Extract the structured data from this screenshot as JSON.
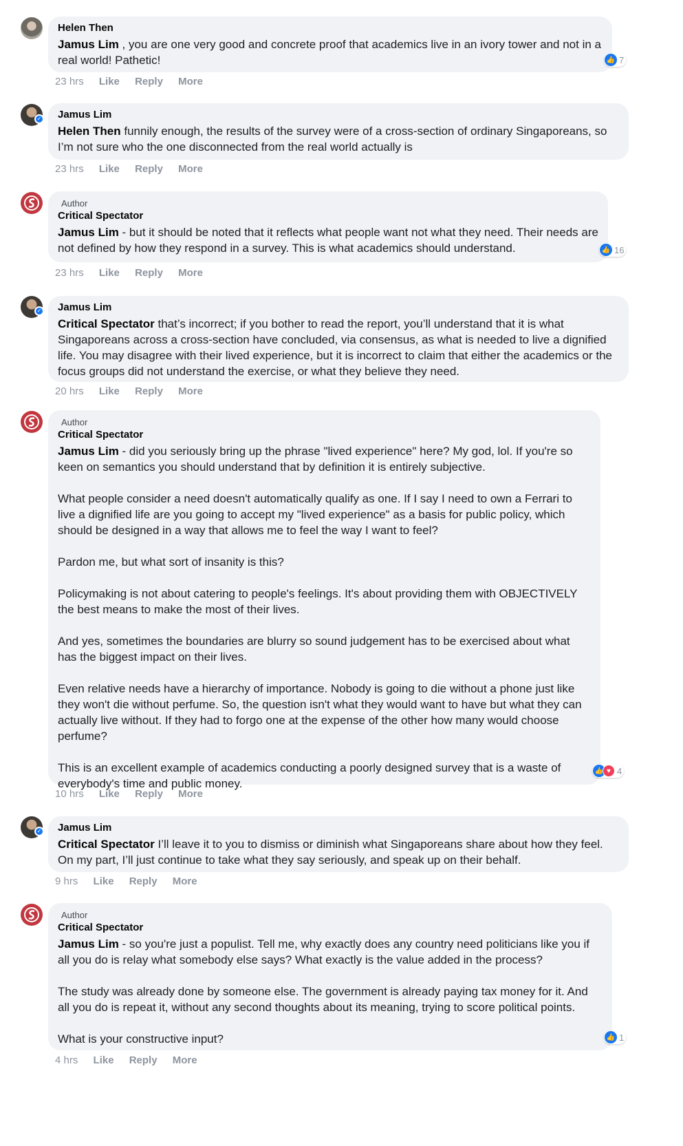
{
  "comments": [
    {
      "name": "Helen Then",
      "mention": "Jamus Lim",
      "paragraphs": [
        " , you are one very good and concrete proof that academics live in an ivory tower and not in a real world! Pathetic!"
      ],
      "time": "23 hrs",
      "reactions": "7"
    },
    {
      "name": "Jamus Lim",
      "mention": "Helen Then",
      "paragraphs": [
        " funnily enough, the results of the survey were of a cross-section of ordinary Singaporeans, so I’m not sure who the one disconnected from the real world actually is"
      ],
      "time": "23 hrs"
    },
    {
      "author_tag": "Author",
      "name": "Critical Spectator",
      "mention": "Jamus Lim",
      "paragraphs": [
        " - but it should be noted that it reflects what people want not what they need. Their needs are not defined by how they respond in a survey. This is what academics should understand."
      ],
      "time": "23 hrs",
      "reactions": "16"
    },
    {
      "name": "Jamus Lim",
      "mention": "Critical Spectator",
      "paragraphs": [
        " that’s incorrect; if you bother to read the report, you’ll understand that it is what Singaporeans across a cross-section have concluded, via consensus, as what is needed to live a dignified life. You may disagree with their lived experience, but it is incorrect to claim that either the academics or the focus groups did not understand the exercise, or what they believe they need."
      ],
      "time": "20 hrs"
    },
    {
      "author_tag": "Author",
      "name": "Critical Spectator",
      "mention": "Jamus Lim",
      "paragraphs": [
        " - did you seriously bring up the phrase \"lived experience\" here? My god, lol. If you're so keen on semantics you should understand that by definition it is entirely subjective.",
        "What people consider a need doesn't automatically qualify as one. If I say I need to own a Ferrari to live a dignified life are you going to accept my \"lived experience\" as a basis for public policy, which should be designed in a way that allows me to feel the way I want to feel?",
        "Pardon me, but what sort of insanity is this?",
        "Policymaking is not about catering to people's feelings. It's about providing them with OBJECTIVELY the best means to make the most of their lives.",
        "And yes, sometimes the boundaries are blurry so sound judgement has to be exercised about what has the biggest impact on their lives.",
        "Even relative needs have a hierarchy of importance. Nobody is going to die without a phone just like they won't die without perfume. So, the question isn't what they would want to have but what they can actually live without. If they had to forgo one at the expense of the other how many would choose perfume?",
        "This is an excellent example of academics conducting a poorly designed survey that is a waste of everybody's time and public money."
      ],
      "time": "10 hrs",
      "reactions": "4"
    },
    {
      "name": "Jamus Lim",
      "mention": "Critical Spectator",
      "paragraphs": [
        " I’ll leave it to you to dismiss or diminish what Singaporeans share about how they feel. On my part, I’ll just continue to take what they say seriously, and speak up on their behalf."
      ],
      "time": "9 hrs"
    },
    {
      "author_tag": "Author",
      "name": "Critical Spectator",
      "mention": "Jamus Lim",
      "paragraphs": [
        " - so you're just a populist. Tell me, why exactly does any country need politicians like you if all you do is relay what somebody else says? What exactly is the value added in the process?",
        "The study was already done by someone else. The government is already paying tax money for it. And all you do is repeat it, without any second thoughts about its meaning, trying to score political points.",
        "What is your constructive input?"
      ],
      "time": "4 hrs",
      "reactions": "1"
    }
  ],
  "actions": {
    "like": "Like",
    "reply": "Reply",
    "more": "More"
  }
}
